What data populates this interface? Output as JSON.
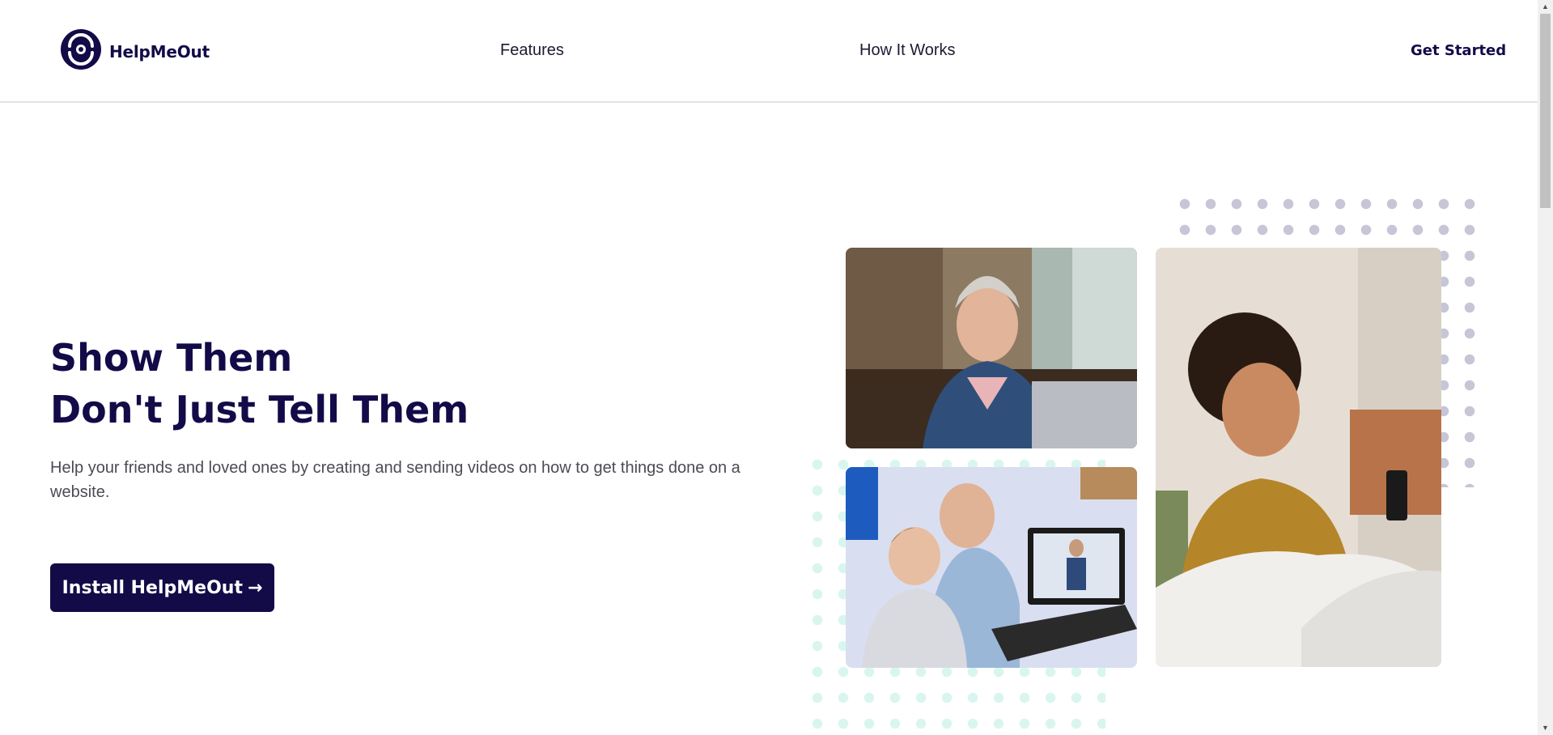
{
  "header": {
    "logo_text": "HelpMeOut",
    "nav": {
      "features": "Features",
      "how_it_works": "How It Works"
    },
    "cta": "Get Started"
  },
  "hero": {
    "headline_line1": "Show Them",
    "headline_line2": "Don't Just Tell Them",
    "subtext": "Help your friends and loved ones by creating and sending videos on how to get things done on a website.",
    "install_button": "Install HelpMeOut",
    "install_arrow": "→"
  },
  "images": [
    {
      "name": "woman-with-headphones-laptop"
    },
    {
      "name": "man-and-boy-laptop-video"
    },
    {
      "name": "woman-smiling-phone"
    }
  ],
  "colors": {
    "brand": "#120b48",
    "dots_gray": "#c6c6d6",
    "dots_mint": "#d8f6ef"
  },
  "scrollbar": {
    "up_icon": "▲",
    "down_icon": "▼"
  }
}
